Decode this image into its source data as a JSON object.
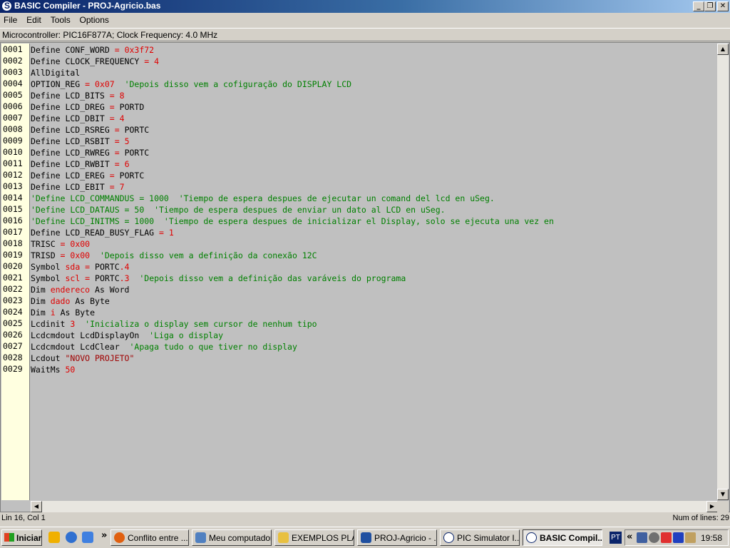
{
  "window": {
    "title": "BASIC Compiler - PROJ-Agricio.bas",
    "buttons": [
      "_",
      "❐",
      "✕"
    ]
  },
  "menu": [
    "File",
    "Edit",
    "Tools",
    "Options"
  ],
  "infobar": {
    "text": "Microcontroller: PIC16F877A;  Clock Frequency: 4.0 MHz"
  },
  "editor": {
    "line_numbers": [
      "0001",
      "0002",
      "0003",
      "0004",
      "0005",
      "0006",
      "0007",
      "0008",
      "0009",
      "0010",
      "0011",
      "0012",
      "0013",
      "0014",
      "0015",
      "0016",
      "0017",
      "0018",
      "0019",
      "0020",
      "0021",
      "0022",
      "0023",
      "0024",
      "0025",
      "0026",
      "0027",
      "0028",
      "0029"
    ],
    "lines": [
      [
        [
          "kw",
          "Define CONF_WORD "
        ],
        [
          "op",
          "= "
        ],
        [
          "num",
          "0x3f72"
        ]
      ],
      [
        [
          "kw",
          "Define CLOCK_FREQUENCY "
        ],
        [
          "op",
          "= "
        ],
        [
          "num",
          "4"
        ]
      ],
      [
        [
          "kw",
          "AllDigital"
        ]
      ],
      [
        [
          "kw",
          "OPTION_REG "
        ],
        [
          "op",
          "= "
        ],
        [
          "num",
          "0x07"
        ],
        [
          "cm",
          "  'Depois disso vem a cofiguração do DISPLAY LCD"
        ]
      ],
      [
        [
          "kw",
          "Define LCD_BITS "
        ],
        [
          "op",
          "= "
        ],
        [
          "num",
          "8"
        ]
      ],
      [
        [
          "kw",
          "Define LCD_DREG "
        ],
        [
          "op",
          "= "
        ],
        [
          "kw",
          "PORTD"
        ]
      ],
      [
        [
          "kw",
          "Define LCD_DBIT "
        ],
        [
          "op",
          "= "
        ],
        [
          "num",
          "4"
        ]
      ],
      [
        [
          "kw",
          "Define LCD_RSREG "
        ],
        [
          "op",
          "= "
        ],
        [
          "kw",
          "PORTC"
        ]
      ],
      [
        [
          "kw",
          "Define LCD_RSBIT "
        ],
        [
          "op",
          "= "
        ],
        [
          "num",
          "5"
        ]
      ],
      [
        [
          "kw",
          "Define LCD_RWREG "
        ],
        [
          "op",
          "= "
        ],
        [
          "kw",
          "PORTC"
        ]
      ],
      [
        [
          "kw",
          "Define LCD_RWBIT "
        ],
        [
          "op",
          "= "
        ],
        [
          "num",
          "6"
        ]
      ],
      [
        [
          "kw",
          "Define LCD_EREG "
        ],
        [
          "op",
          "= "
        ],
        [
          "kw",
          "PORTC"
        ]
      ],
      [
        [
          "kw",
          "Define LCD_EBIT "
        ],
        [
          "op",
          "= "
        ],
        [
          "num",
          "7"
        ]
      ],
      [
        [
          "cm",
          "'Define LCD_COMMANDUS = 1000  'Tiempo de espera despues de ejecutar un comand del lcd en uSeg."
        ]
      ],
      [
        [
          "cm",
          "'Define LCD_DATAUS = 50  'Tiempo de espera despues de enviar un dato al LCD en uSeg."
        ]
      ],
      [
        [
          "cm",
          "'Define LCD_INITMS = 1000  'Tiempo de espera despues de inicializar el Display, solo se ejecuta una vez en"
        ]
      ],
      [
        [
          "kw",
          "Define LCD_READ_BUSY_FLAG "
        ],
        [
          "op",
          "= "
        ],
        [
          "num",
          "1"
        ]
      ],
      [
        [
          "kw",
          "TRISC "
        ],
        [
          "op",
          "= "
        ],
        [
          "num",
          "0x00"
        ]
      ],
      [
        [
          "kw",
          "TRISD "
        ],
        [
          "op",
          "= "
        ],
        [
          "num",
          "0x00"
        ],
        [
          "cm",
          "  'Depois disso vem a definição da conexão 12C"
        ]
      ],
      [
        [
          "kw",
          "Symbol "
        ],
        [
          "num",
          "sda"
        ],
        [
          "op",
          " = "
        ],
        [
          "kw",
          "PORTC"
        ],
        [
          "num",
          ".4"
        ]
      ],
      [
        [
          "kw",
          "Symbol "
        ],
        [
          "num",
          "scl"
        ],
        [
          "op",
          " = "
        ],
        [
          "kw",
          "PORTC"
        ],
        [
          "num",
          ".3"
        ],
        [
          "cm",
          "  'Depois disso vem a definição das varáveis do programa"
        ]
      ],
      [
        [
          "kw",
          "Dim "
        ],
        [
          "num",
          "endereco"
        ],
        [
          "kw",
          " As Word"
        ]
      ],
      [
        [
          "kw",
          "Dim "
        ],
        [
          "num",
          "dado"
        ],
        [
          "kw",
          " As Byte"
        ]
      ],
      [
        [
          "kw",
          "Dim "
        ],
        [
          "num",
          "i"
        ],
        [
          "kw",
          " As Byte"
        ]
      ],
      [
        [
          "kw",
          "Lcdinit "
        ],
        [
          "num",
          "3"
        ],
        [
          "cm",
          "  'Inicializa o display sem cursor de nenhum tipo"
        ]
      ],
      [
        [
          "kw",
          "Lcdcmdout LcdDisplayOn"
        ],
        [
          "cm",
          "  'Liga o display"
        ]
      ],
      [
        [
          "kw",
          "Lcdcmdout LcdClear"
        ],
        [
          "cm",
          "  'Apaga tudo o que tiver no display"
        ]
      ],
      [
        [
          "kw",
          "Lcdout "
        ],
        [
          "str",
          "\"NOVO PROJETO\""
        ]
      ],
      [
        [
          "kw",
          "WaitMs "
        ],
        [
          "num",
          "50"
        ]
      ]
    ]
  },
  "status": {
    "position": "Lin 16, Col 1",
    "lines": "Num of lines: 29"
  },
  "taskbar": {
    "start": "Iniciar",
    "tasks": [
      {
        "label": "Conflito entre ...",
        "color": "#e06010"
      },
      {
        "label": "Meu computador",
        "color": "#5080c0"
      },
      {
        "label": "EXEMPLOS PLA...",
        "color": "#e8c040"
      },
      {
        "label": "PROJ-Agricio - ...",
        "color": "#2050a0"
      },
      {
        "label": "PIC Simulator I...",
        "color": "#ffffff"
      },
      {
        "label": "BASIC Compil...",
        "color": "#ffffff"
      }
    ],
    "lang": "PT",
    "clock": "19:58"
  }
}
